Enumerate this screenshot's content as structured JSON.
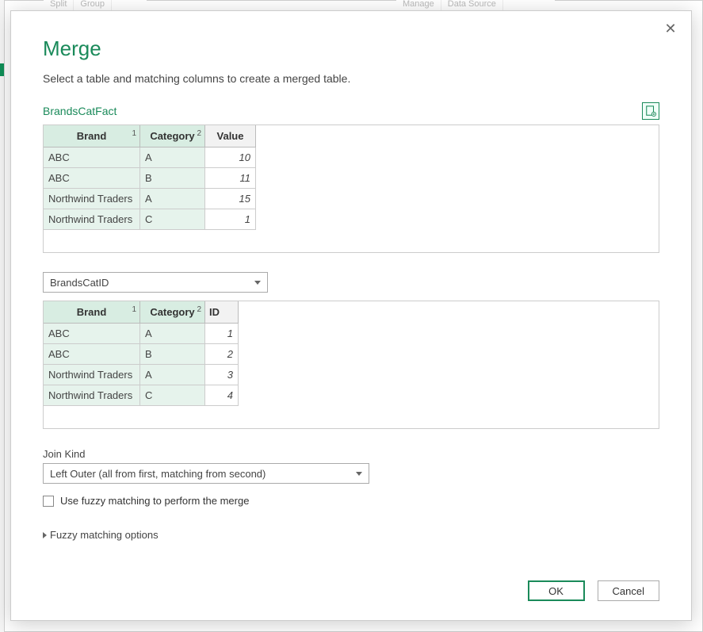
{
  "ribbon": {
    "left_items": [
      "Split",
      "Group"
    ],
    "right_items": [
      "Manage",
      "Data Source"
    ]
  },
  "dialog": {
    "title": "Merge",
    "subtitle": "Select a table and matching columns to create a merged table.",
    "close_glyph": "✕"
  },
  "table1": {
    "name": "BrandsCatFact",
    "columns": [
      {
        "label": "Brand",
        "sort": "1"
      },
      {
        "label": "Category",
        "sort": "2"
      },
      {
        "label": "Value",
        "sort": ""
      }
    ],
    "rows": [
      {
        "brand": "ABC",
        "category": "A",
        "value": "10"
      },
      {
        "brand": "ABC",
        "category": "B",
        "value": "11"
      },
      {
        "brand": "Northwind Traders",
        "category": "A",
        "value": "15"
      },
      {
        "brand": "Northwind Traders",
        "category": "C",
        "value": "1"
      }
    ]
  },
  "table2": {
    "selector_value": "BrandsCatID",
    "columns": [
      {
        "label": "Brand",
        "sort": "1"
      },
      {
        "label": "Category",
        "sort": "2"
      },
      {
        "label": "ID",
        "sort": ""
      }
    ],
    "rows": [
      {
        "brand": "ABC",
        "category": "A",
        "id": "1"
      },
      {
        "brand": "ABC",
        "category": "B",
        "id": "2"
      },
      {
        "brand": "Northwind Traders",
        "category": "A",
        "id": "3"
      },
      {
        "brand": "Northwind Traders",
        "category": "C",
        "id": "4"
      }
    ]
  },
  "join": {
    "label": "Join Kind",
    "value": "Left Outer (all from first, matching from second)"
  },
  "fuzzy": {
    "checkbox_label": "Use fuzzy matching to perform the merge",
    "expander_label": "Fuzzy matching options"
  },
  "buttons": {
    "ok": "OK",
    "cancel": "Cancel"
  }
}
